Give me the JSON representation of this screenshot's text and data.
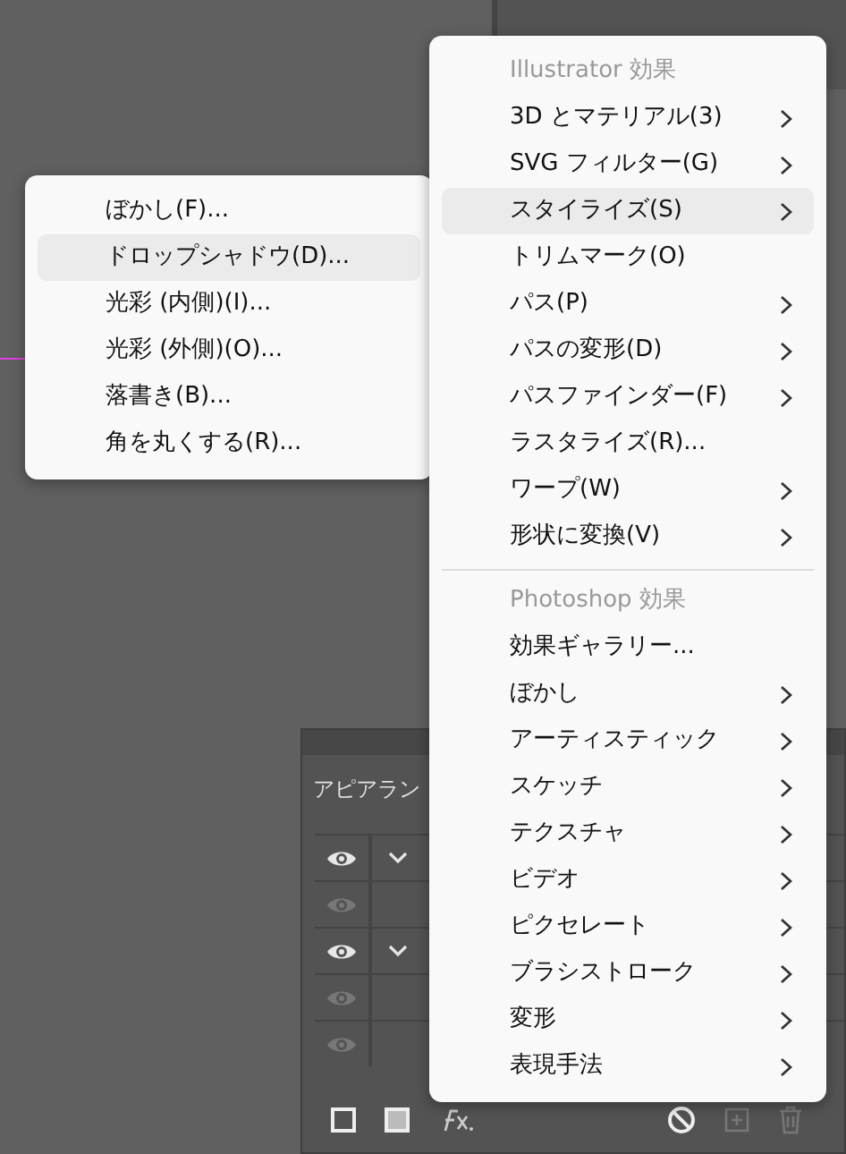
{
  "main_menu": {
    "items": [
      {
        "kind": "header",
        "label": "Illustrator 効果"
      },
      {
        "kind": "item",
        "label": "3D とマテリアル(3)",
        "submenu": true,
        "selected": false
      },
      {
        "kind": "item",
        "label": "SVG フィルター(G)",
        "submenu": true,
        "selected": false
      },
      {
        "kind": "item",
        "label": "スタイライズ(S)",
        "submenu": true,
        "selected": true
      },
      {
        "kind": "item",
        "label": "トリムマーク(O)",
        "submenu": false,
        "selected": false
      },
      {
        "kind": "item",
        "label": "パス(P)",
        "submenu": true,
        "selected": false
      },
      {
        "kind": "item",
        "label": "パスの変形(D)",
        "submenu": true,
        "selected": false
      },
      {
        "kind": "item",
        "label": "パスファインダー(F)",
        "submenu": true,
        "selected": false
      },
      {
        "kind": "item",
        "label": "ラスタライズ(R)...",
        "submenu": false,
        "selected": false
      },
      {
        "kind": "item",
        "label": "ワープ(W)",
        "submenu": true,
        "selected": false
      },
      {
        "kind": "item",
        "label": "形状に変換(V)",
        "submenu": true,
        "selected": false
      },
      {
        "kind": "separator"
      },
      {
        "kind": "header",
        "label": "Photoshop 効果"
      },
      {
        "kind": "item",
        "label": "効果ギャラリー...",
        "submenu": false,
        "selected": false
      },
      {
        "kind": "item",
        "label": "ぼかし",
        "submenu": true,
        "selected": false
      },
      {
        "kind": "item",
        "label": "アーティスティック",
        "submenu": true,
        "selected": false
      },
      {
        "kind": "item",
        "label": "スケッチ",
        "submenu": true,
        "selected": false
      },
      {
        "kind": "item",
        "label": "テクスチャ",
        "submenu": true,
        "selected": false
      },
      {
        "kind": "item",
        "label": "ビデオ",
        "submenu": true,
        "selected": false
      },
      {
        "kind": "item",
        "label": "ピクセレート",
        "submenu": true,
        "selected": false
      },
      {
        "kind": "item",
        "label": "ブラシストローク",
        "submenu": true,
        "selected": false
      },
      {
        "kind": "item",
        "label": "変形",
        "submenu": true,
        "selected": false
      },
      {
        "kind": "item",
        "label": "表現手法",
        "submenu": true,
        "selected": false
      }
    ]
  },
  "submenu": {
    "items": [
      {
        "label": "ぼかし(F)...",
        "selected": false
      },
      {
        "label": "ドロップシャドウ(D)...",
        "selected": true
      },
      {
        "label": "光彩 (内側)(I)...",
        "selected": false
      },
      {
        "label": "光彩 (外側)(O)...",
        "selected": false
      },
      {
        "label": "落書き(B)...",
        "selected": false
      },
      {
        "label": "角を丸くする(R)...",
        "selected": false
      }
    ]
  },
  "appearance_panel": {
    "title": "アピアラン",
    "rows": [
      {
        "visible": true,
        "expandable": true
      },
      {
        "visible": false,
        "expandable": false
      },
      {
        "visible": true,
        "expandable": true
      },
      {
        "visible": false,
        "expandable": false
      },
      {
        "visible": false,
        "expandable": false
      }
    ]
  }
}
